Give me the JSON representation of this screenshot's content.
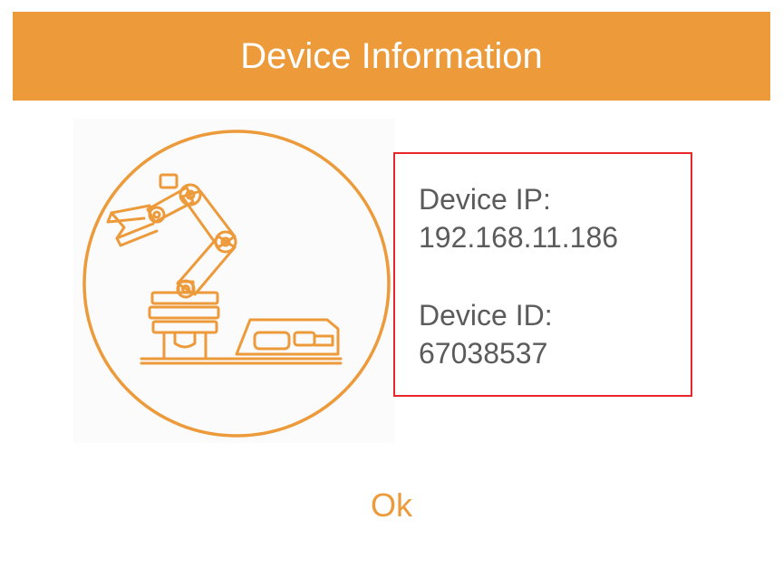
{
  "dialog": {
    "title": "Device Information",
    "illustration_icon": "robotic-arm-icon",
    "accent_color": "#EC9A3A",
    "highlight_color": "#E8262C"
  },
  "device": {
    "ip_label": "Device IP:",
    "ip_value": "192.168.11.186",
    "id_label": "Device ID:",
    "id_value": "67038537"
  },
  "actions": {
    "ok_label": "Ok"
  }
}
